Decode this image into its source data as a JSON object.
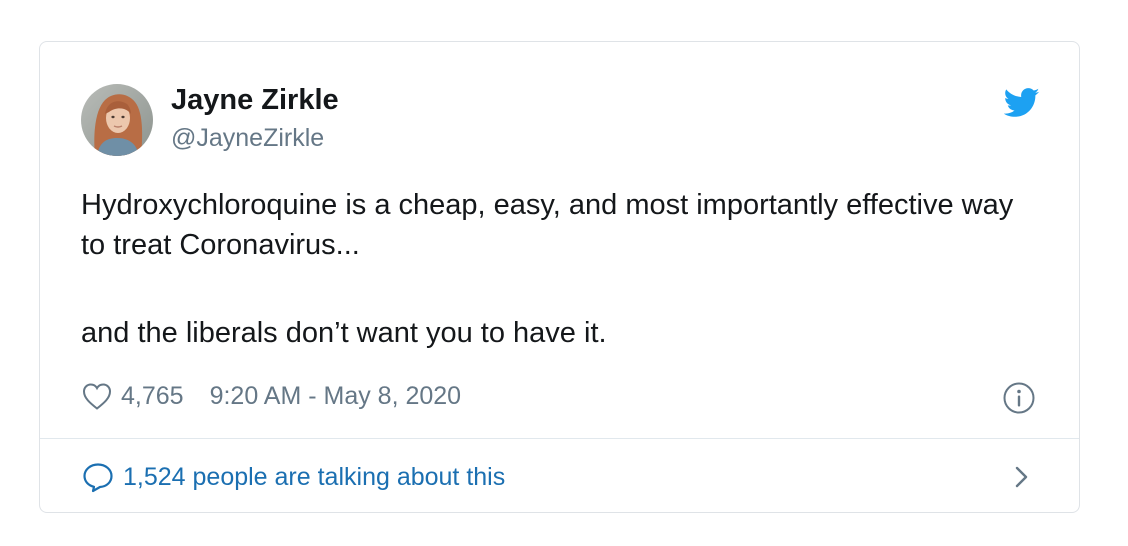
{
  "author": {
    "name": "Jayne Zirkle",
    "handle": "@JayneZirkle",
    "avatar_icon": "avatar-photo"
  },
  "tweet": {
    "paragraphs": [
      "Hydroxychloroquine is a cheap, easy, and most importantly effective way to treat Coronavirus...",
      "and the liberals don’t want you to have it."
    ]
  },
  "meta": {
    "likes": "4,765",
    "timestamp": "9:20 AM - May 8, 2020"
  },
  "conversation": {
    "label": "1,524 people are talking about this"
  },
  "icons": {
    "brand": "twitter-bird-icon",
    "like": "heart-icon",
    "info": "info-icon",
    "reply": "speech-bubble-icon",
    "more": "chevron-right-icon"
  },
  "colors": {
    "brand": "#1da1f2",
    "text": "#14171a",
    "muted": "#657786",
    "link": "#1b6fb1",
    "border": "#dfe3e7"
  }
}
